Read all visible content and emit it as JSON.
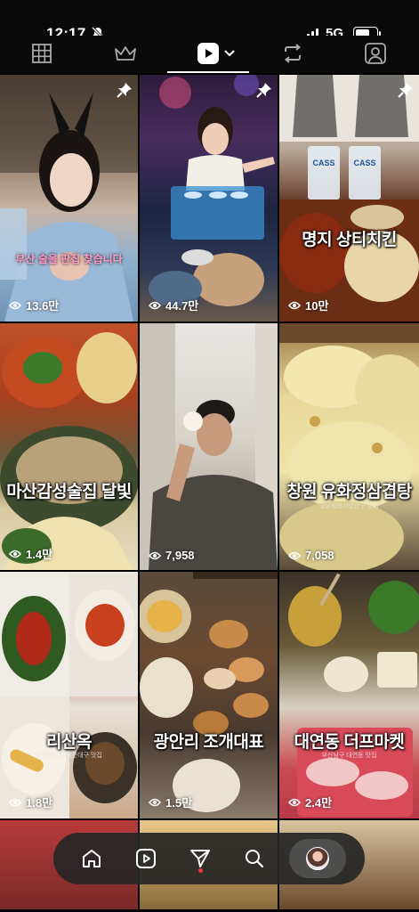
{
  "status_bar": {
    "time": "12:17",
    "network": "5G",
    "battery_level": 0.7,
    "icons": [
      "bell-off-icon",
      "signal-icon",
      "battery-icon"
    ]
  },
  "top_nav": {
    "items": [
      {
        "name": "grid-icon"
      },
      {
        "name": "crown-icon"
      },
      {
        "name": "reels-icon",
        "active": true
      },
      {
        "name": "chevron-down-icon"
      },
      {
        "name": "repost-icon"
      },
      {
        "name": "tagged-icon"
      }
    ]
  },
  "tiles": [
    {
      "views": "13.6만",
      "pinned": true,
      "overlay": "",
      "subtitle": "부산 술을 판집 찾습니다",
      "caption": ""
    },
    {
      "views": "44.7만",
      "pinned": true,
      "overlay": "",
      "subtitle": "",
      "caption": ""
    },
    {
      "views": "10만",
      "pinned": true,
      "overlay": "명지 상티치킨",
      "subtitle": "",
      "caption": ""
    },
    {
      "views": "1.4만",
      "pinned": false,
      "overlay": "마산감성술집 달빛",
      "subtitle": "",
      "caption": ""
    },
    {
      "views": "7,958",
      "pinned": false,
      "overlay": "",
      "subtitle": "",
      "caption": ""
    },
    {
      "views": "7,058",
      "pinned": false,
      "overlay": "창원 유화정삼겹탕",
      "subtitle": "",
      "caption": "경남창원시성산구 맛집"
    },
    {
      "views": "1.8만",
      "pinned": false,
      "overlay": "리산옥",
      "subtitle": "",
      "caption": "부산광역시 해운대구 맛집"
    },
    {
      "views": "1.5만",
      "pinned": false,
      "overlay": "광안리 조개대표",
      "subtitle": "",
      "caption": ""
    },
    {
      "views": "2.4만",
      "pinned": false,
      "overlay": "대연동 더프마켓",
      "subtitle": "",
      "caption": "부산남구 대연동 맛집"
    }
  ],
  "tab_bar": {
    "items": [
      {
        "name": "home-icon"
      },
      {
        "name": "reels-tab-icon"
      },
      {
        "name": "send-icon",
        "has_notification": true
      },
      {
        "name": "search-icon"
      },
      {
        "name": "profile-avatar"
      }
    ]
  },
  "colors": {
    "background": "#000000",
    "notification": "#ff3040",
    "subtitle_pink": "#ff9ec8"
  }
}
